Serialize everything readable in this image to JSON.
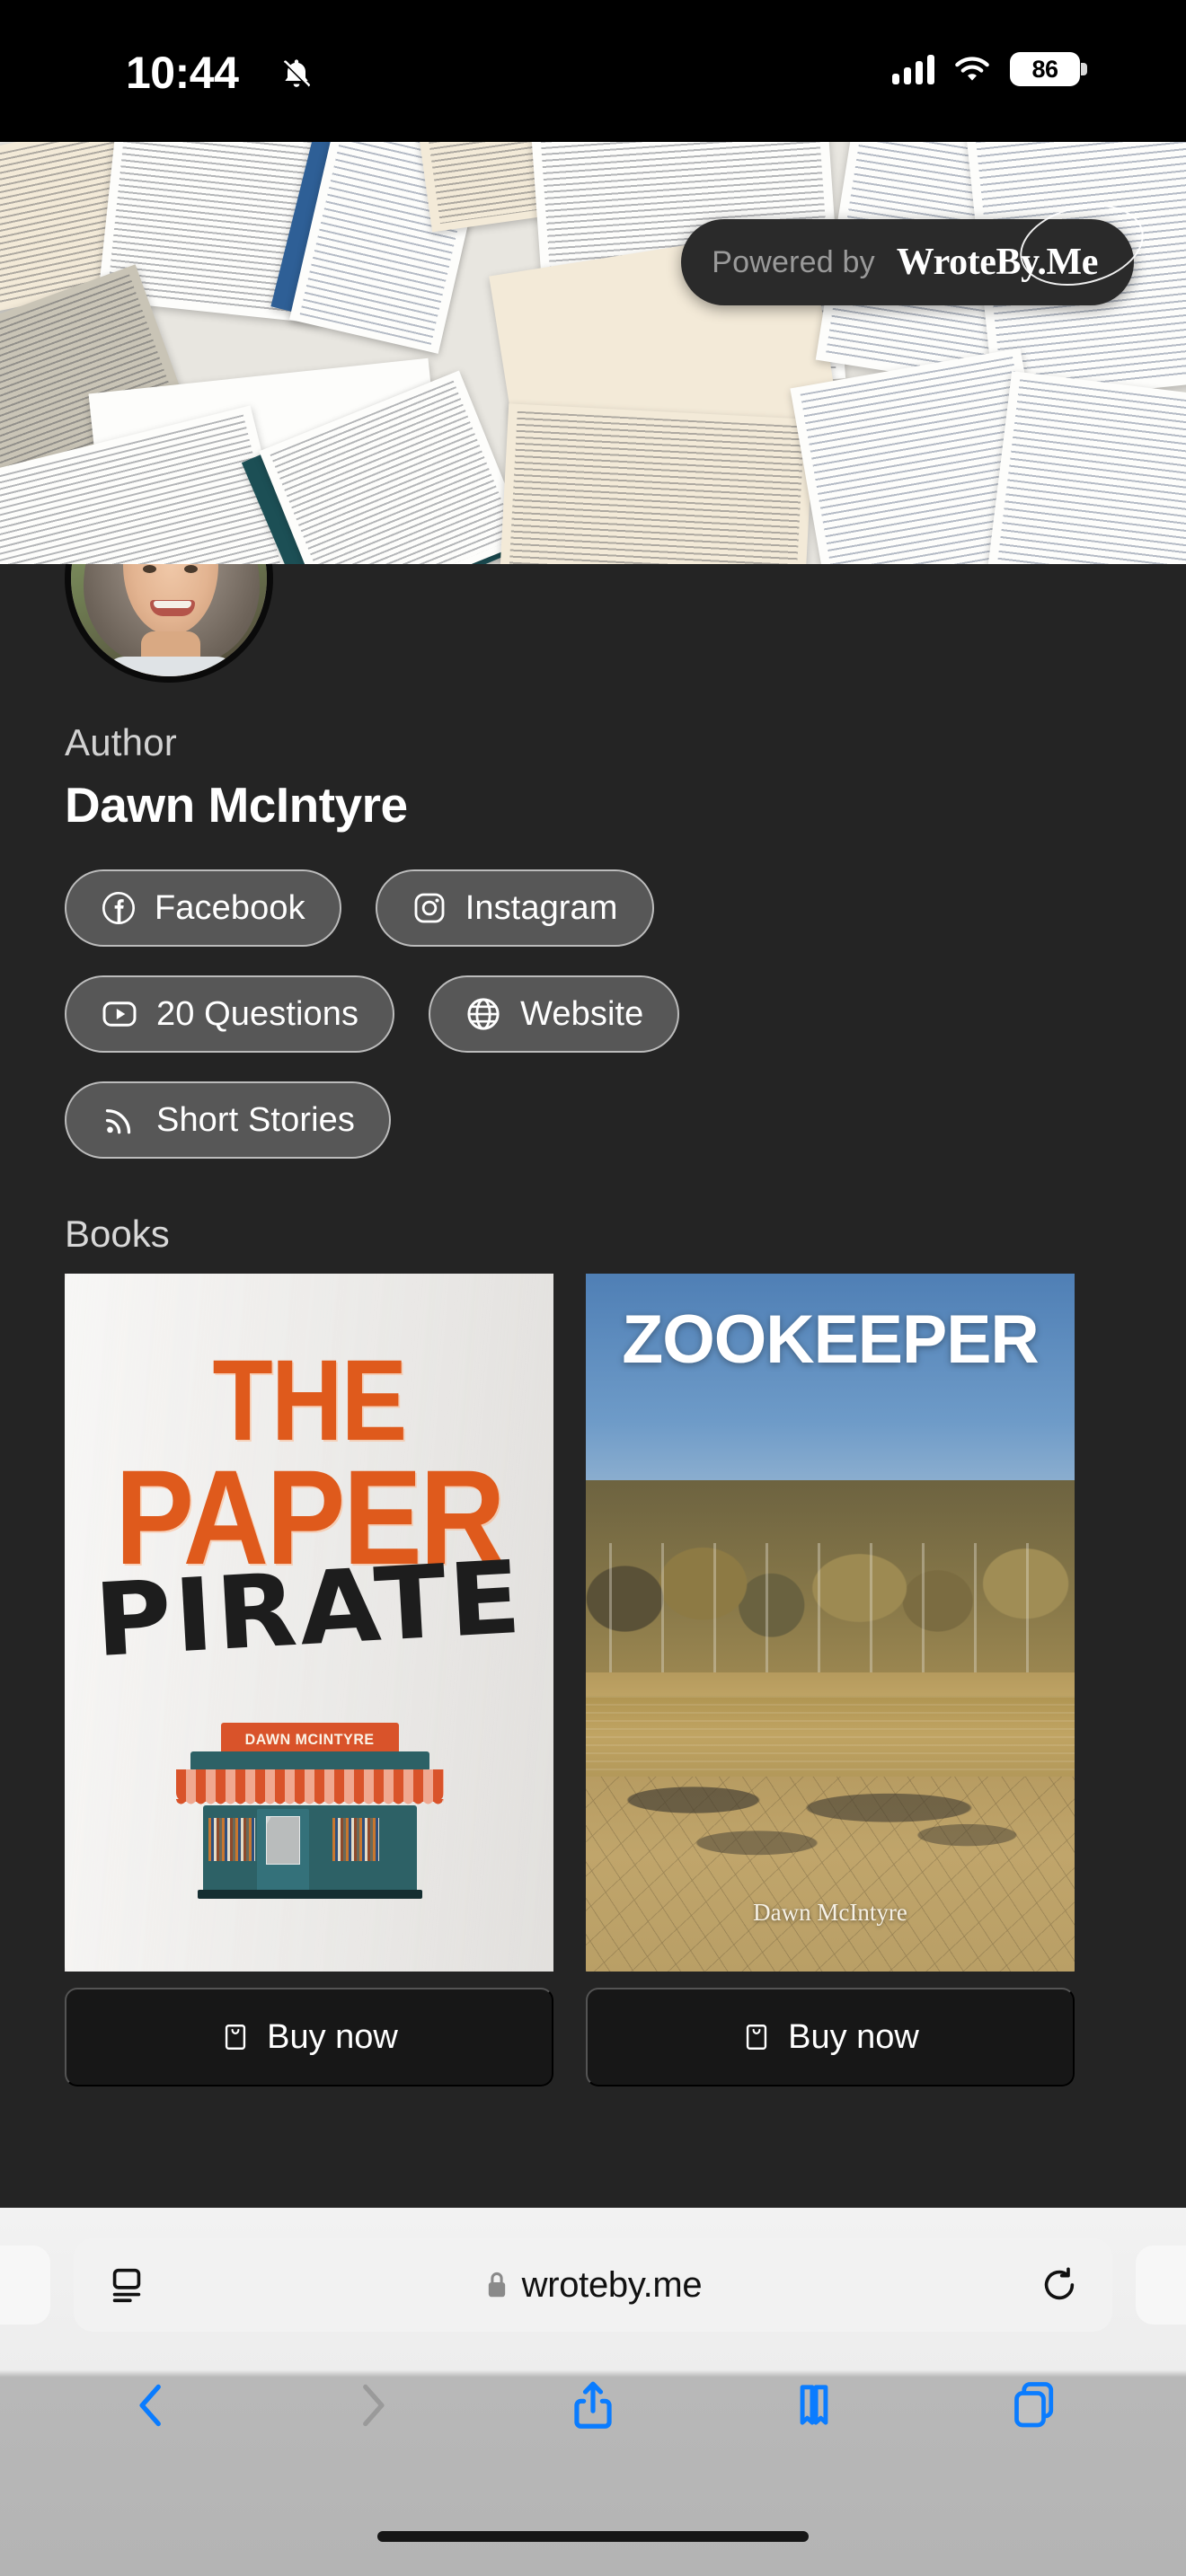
{
  "status_bar": {
    "time": "10:44",
    "silent_icon": "bell-slash-icon",
    "signal_icon": "cellular-signal-icon",
    "signal_bars": 4,
    "wifi_icon": "wifi-icon",
    "battery_percent": "86",
    "battery_icon": "battery-icon"
  },
  "banner": {
    "image_alt": "open-books-photo",
    "powered_by_label": "Powered by",
    "brand": "WroteBy.Me"
  },
  "profile": {
    "avatar_alt": "author-portrait",
    "role": "Author",
    "name": "Dawn McIntyre"
  },
  "links": [
    {
      "label": "Facebook",
      "icon": "facebook-icon"
    },
    {
      "label": "Instagram",
      "icon": "instagram-icon"
    },
    {
      "label": "20 Questions",
      "icon": "youtube-play-icon"
    },
    {
      "label": "Website",
      "icon": "globe-icon"
    },
    {
      "label": "Short Stories",
      "icon": "rss-feed-icon"
    }
  ],
  "books_section": {
    "heading": "Books",
    "items": [
      {
        "title_line1": "THE",
        "title_line2": "PAPER",
        "title_line3": "PIRATE",
        "shop_sign": "DAWN MCINTYRE",
        "buy_label": "Buy now",
        "buy_icon": "book-bag-icon"
      },
      {
        "title": "ZOOKEEPER",
        "author": "Dawn McIntyre",
        "buy_label": "Buy now",
        "buy_icon": "book-bag-icon"
      }
    ]
  },
  "browser": {
    "page_settings_icon": "page-settings-icon",
    "lock_icon": "lock-icon",
    "url": "wroteby.me",
    "reload_icon": "reload-icon",
    "back_icon": "back-chevron-icon",
    "forward_icon": "forward-chevron-icon",
    "share_icon": "share-icon",
    "bookmarks_icon": "bookmarks-icon",
    "tabs_icon": "tabs-icon"
  },
  "colors": {
    "page_bg": "#242424",
    "pill_bg": "#575757",
    "accent_orange": "#df5a1c",
    "safari_blue": "#0a7cff"
  }
}
